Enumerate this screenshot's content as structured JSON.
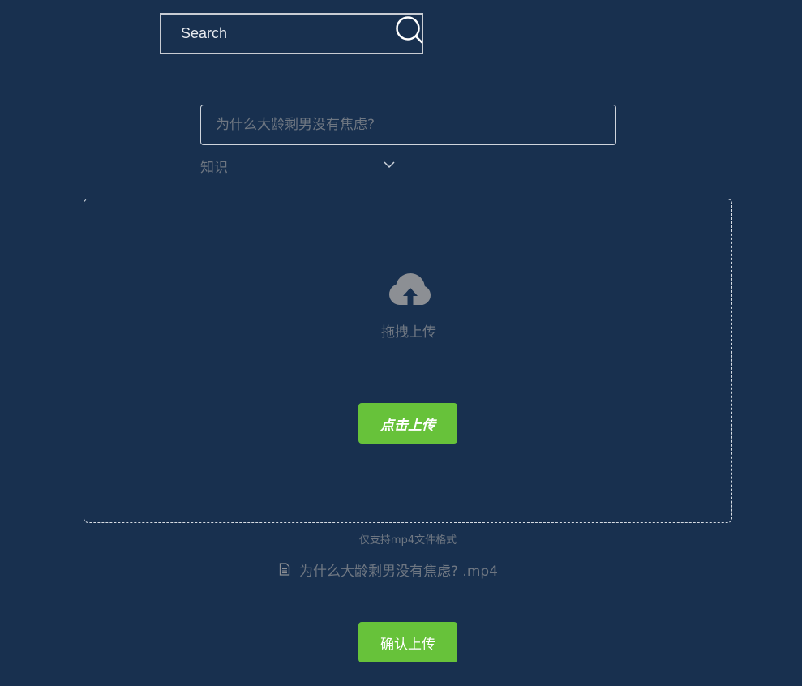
{
  "search": {
    "placeholder": "Search",
    "icon": "search-icon"
  },
  "form": {
    "title_placeholder": "为什么大龄剩男没有焦虑?",
    "category_selected": "知识"
  },
  "dropzone": {
    "icon": "cloud-upload-icon",
    "drag_text": "拖拽上传",
    "click_upload_label": "点击上传"
  },
  "format_hint": "仅支持mp4文件格式",
  "file": {
    "icon": "document-icon",
    "name": "为什么大龄剩男没有焦虑? .mp4"
  },
  "confirm_label": "确认上传",
  "colors": {
    "background": "#18304f",
    "accent_green": "#67c23a",
    "muted_text": "#6f7782",
    "border_light": "#c8ccd3"
  }
}
